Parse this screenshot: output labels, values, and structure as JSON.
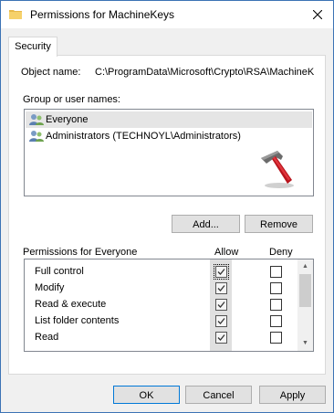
{
  "window": {
    "title": "Permissions for MachineKeys"
  },
  "tabs": [
    {
      "label": "Security"
    }
  ],
  "object": {
    "label": "Object name:",
    "value": "C:\\ProgramData\\Microsoft\\Crypto\\RSA\\MachineK"
  },
  "groups": {
    "label": "Group or user names:",
    "items": [
      {
        "name": "Everyone"
      },
      {
        "name": "Administrators (TECHNOYL\\Administrators)"
      }
    ],
    "add_label": "Add...",
    "remove_label": "Remove"
  },
  "permissions": {
    "label": "Permissions for Everyone",
    "allow_header": "Allow",
    "deny_header": "Deny",
    "rows": [
      {
        "name": "Full control",
        "allow": true,
        "deny": false
      },
      {
        "name": "Modify",
        "allow": true,
        "deny": false
      },
      {
        "name": "Read & execute",
        "allow": true,
        "deny": false
      },
      {
        "name": "List folder contents",
        "allow": true,
        "deny": false
      },
      {
        "name": "Read",
        "allow": true,
        "deny": false
      }
    ]
  },
  "footer": {
    "ok_label": "OK",
    "cancel_label": "Cancel",
    "apply_label": "Apply"
  },
  "icons": {
    "close": "close-icon",
    "folder": "folder-icon",
    "user": "user-group-icon",
    "watermark": "hammer-icon"
  }
}
